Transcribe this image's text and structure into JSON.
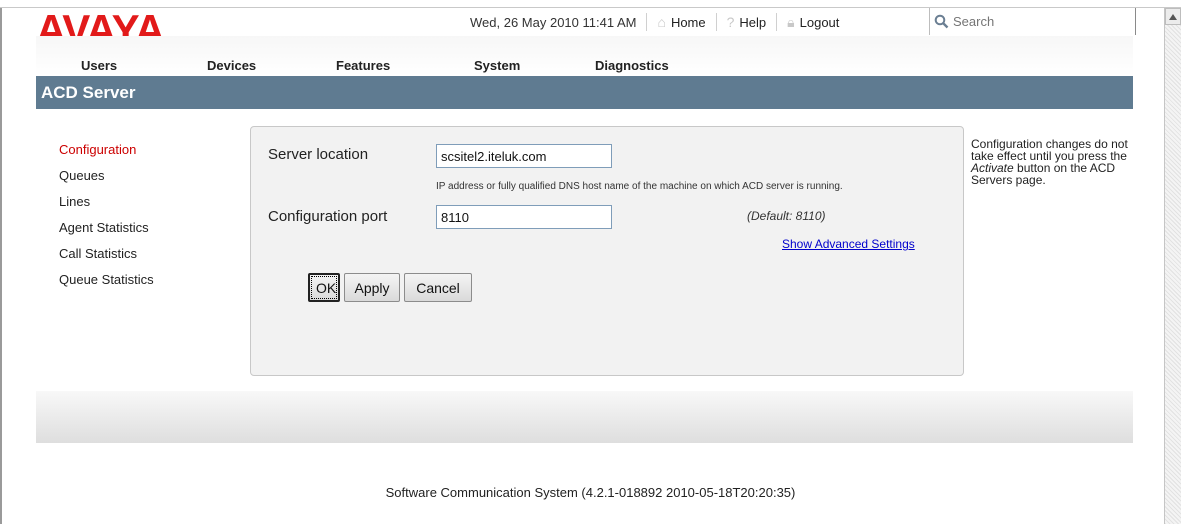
{
  "brand": {
    "logo_text": "AVAYA",
    "logo_color": "#e21a1a"
  },
  "topbar": {
    "datetime": "Wed, 26 May 2010 11:41 AM",
    "home_label": "Home",
    "help_label": "Help",
    "logout_label": "Logout",
    "search_placeholder": "Search"
  },
  "nav": {
    "users": "Users",
    "devices": "Devices",
    "features": "Features",
    "system": "System",
    "diagnostics": "Diagnostics"
  },
  "page": {
    "title": "ACD Server",
    "title_bar_color": "#5f7b91"
  },
  "sidebar": {
    "items": [
      {
        "label": "Configuration",
        "active": true
      },
      {
        "label": "Queues"
      },
      {
        "label": "Lines"
      },
      {
        "label": "Agent Statistics"
      },
      {
        "label": "Call Statistics"
      },
      {
        "label": "Queue Statistics"
      }
    ]
  },
  "form": {
    "server_location_label": "Server location",
    "server_location_value": "scsitel2.iteluk.com",
    "server_location_hint": "IP address or fully qualified DNS host name of the machine on which ACD server is running.",
    "config_port_label": "Configuration port",
    "config_port_value": "8110",
    "config_port_default": "(Default: 8110)",
    "advanced_link": "Show Advanced Settings"
  },
  "buttons": {
    "ok": "OK",
    "apply": "Apply",
    "cancel": "Cancel"
  },
  "sidenote": {
    "before": "Configuration changes do not take effect until you press the ",
    "emphasis": "Activate",
    "after": " button on the ACD Servers page."
  },
  "footer": {
    "text": "Software Communication System (4.2.1-018892 2010-05-18T20:20:35)"
  }
}
